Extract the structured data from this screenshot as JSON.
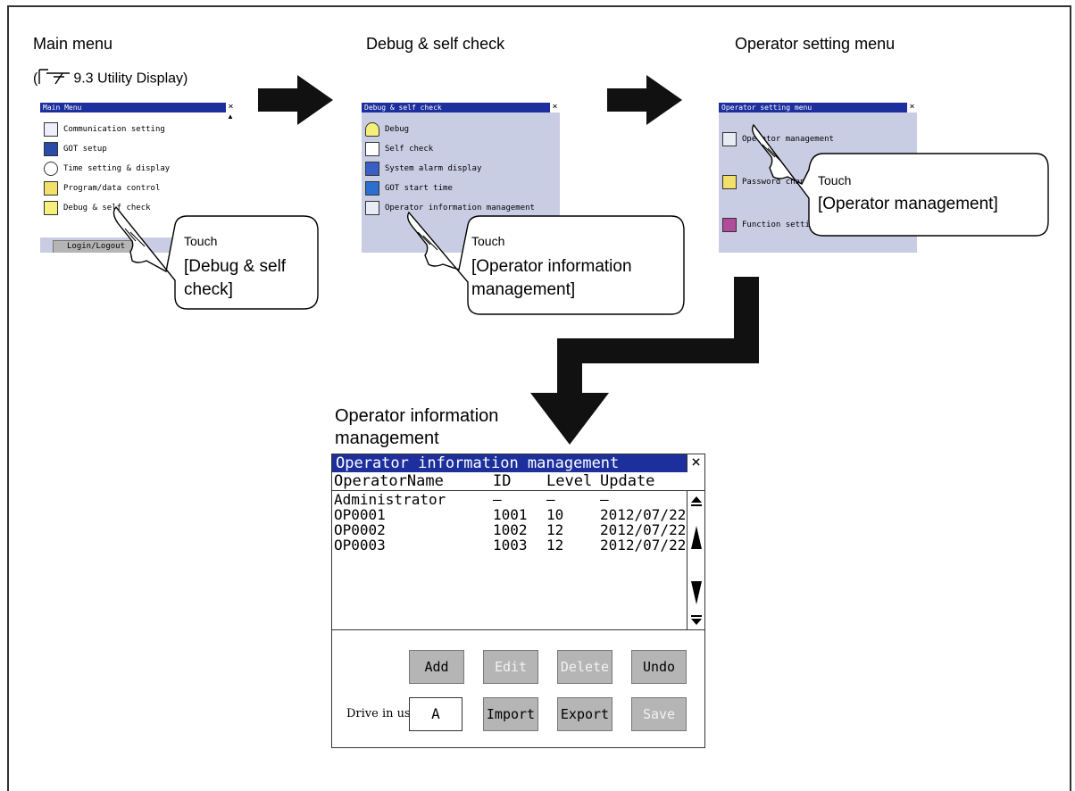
{
  "captions": {
    "main_menu": "Main menu",
    "reference": "9.3 Utility Display",
    "debug_self_check": "Debug & self check",
    "operator_setting_menu": "Operator setting menu",
    "operator_info_mgmt_line1": "Operator information",
    "operator_info_mgmt_line2": "management"
  },
  "main_menu_screen": {
    "title": "Main Menu",
    "close": "×",
    "items": [
      {
        "label": "Communication setting",
        "icon": "communication-icon"
      },
      {
        "label": "GOT setup",
        "icon": "got-setup-icon"
      },
      {
        "label": "Time setting & display",
        "icon": "clock-icon"
      },
      {
        "label": "Program/data control",
        "icon": "folder-icon"
      },
      {
        "label": "Debug & self check",
        "icon": "debug-icon"
      }
    ],
    "login_button": "Login/Logout"
  },
  "debug_screen": {
    "title": "Debug & self check",
    "close": "×",
    "items": [
      {
        "label": "Debug",
        "icon": "debug-icon"
      },
      {
        "label": "Self check",
        "icon": "self-check-icon"
      },
      {
        "label": "System alarm display",
        "icon": "alarm-icon"
      },
      {
        "label": "GOT start time",
        "icon": "start-time-icon"
      },
      {
        "label": "Operator information management",
        "icon": "operator-info-icon"
      }
    ]
  },
  "operator_setting_screen": {
    "title": "Operator setting menu",
    "close": "×",
    "items": [
      {
        "label": "Operator management",
        "icon": "operator-management-icon"
      },
      {
        "label": "Password change",
        "icon": "password-icon"
      },
      {
        "label": "Function setting",
        "icon": "function-setting-icon"
      }
    ]
  },
  "callouts": {
    "c1_touch": "Touch",
    "c1_target_line1": "[Debug & self",
    "c1_target_line2": "check]",
    "c2_touch": "Touch",
    "c2_target_line1": "[Operator information",
    "c2_target_line2": "management]",
    "c3_touch": "Touch",
    "c3_target": "[Operator management]"
  },
  "operator_info_screen": {
    "title": "Operator information management",
    "close": "×",
    "columns": [
      "OperatorName",
      "ID",
      "Level",
      "Update"
    ],
    "rows": [
      {
        "name": "Administrator",
        "id": "–",
        "level": "–",
        "update": "–"
      },
      {
        "name": "OP0001",
        "id": "1001",
        "level": "10",
        "update": "2012/07/22"
      },
      {
        "name": "OP0002",
        "id": "1002",
        "level": "12",
        "update": "2012/07/22"
      },
      {
        "name": "OP0003",
        "id": "1003",
        "level": "12",
        "update": "2012/07/22"
      }
    ],
    "buttons": {
      "add": "Add",
      "edit": "Edit",
      "delete": "Delete",
      "undo": "Undo",
      "import": "Import",
      "export": "Export",
      "save": "Save"
    },
    "drive_label": "Drive in use",
    "drive_value": "A"
  },
  "colors": {
    "title_bar": "#1d2f9c",
    "screen_bg": "#c9cde4",
    "button_bg": "#b5b5b5",
    "arrow": "#111111"
  }
}
